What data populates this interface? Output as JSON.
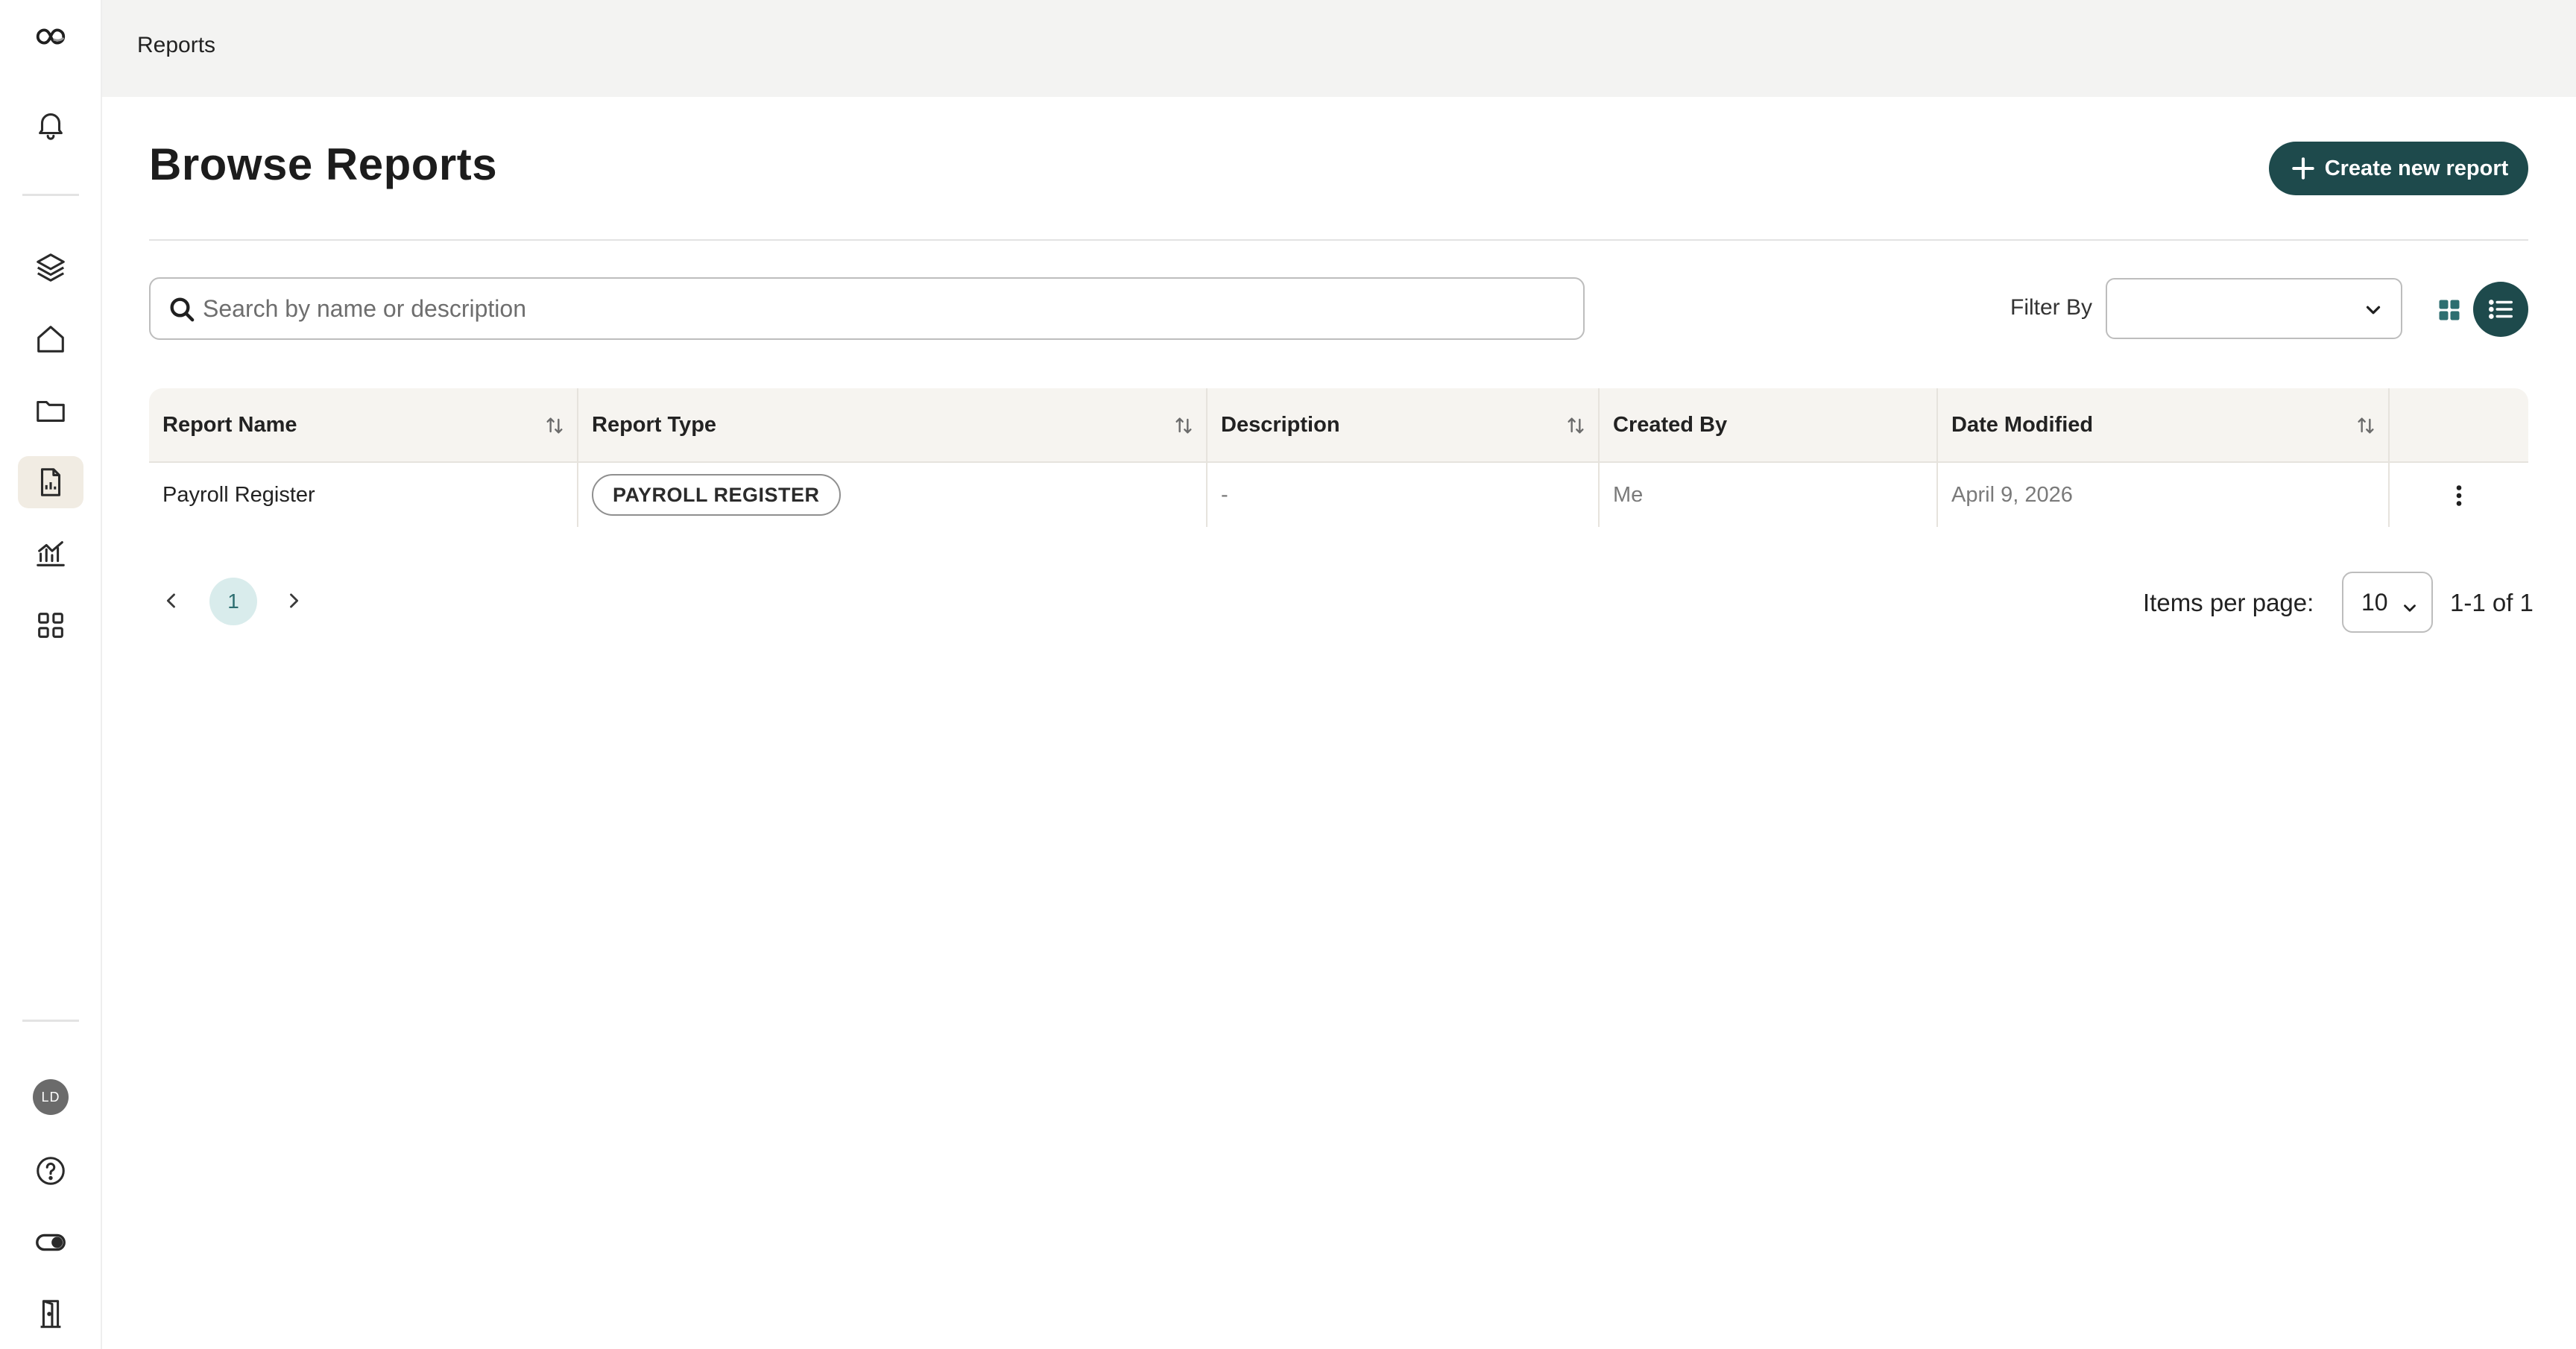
{
  "breadcrumb": {
    "current": "Reports"
  },
  "page": {
    "title": "Browse Reports",
    "create_button_label": "Create new report"
  },
  "search": {
    "value": "",
    "placeholder": "Search by name or description"
  },
  "filter": {
    "label": "Filter By",
    "selected": ""
  },
  "sidebar": {
    "avatar_initials": "LD",
    "active_item": "reports",
    "items": [
      {
        "id": "notifications",
        "icon": "bell-icon"
      },
      {
        "id": "layers",
        "icon": "layers-icon"
      },
      {
        "id": "home",
        "icon": "home-icon"
      },
      {
        "id": "files",
        "icon": "folder-icon"
      },
      {
        "id": "reports",
        "icon": "report-document-icon"
      },
      {
        "id": "analytics",
        "icon": "line-chart-icon"
      },
      {
        "id": "apps",
        "icon": "grid-icon"
      },
      {
        "id": "help",
        "icon": "help-icon"
      },
      {
        "id": "theme-toggle",
        "icon": "toggle-icon"
      },
      {
        "id": "logout",
        "icon": "door-icon"
      }
    ]
  },
  "table": {
    "columns": [
      "Report Name",
      "Report Type",
      "Description",
      "Created By",
      "Date Modified"
    ],
    "rows": [
      {
        "name": "Payroll Register",
        "type": "PAYROLL REGISTER",
        "description": "-",
        "created_by": "Me",
        "date_modified": "April 9, 2026"
      }
    ]
  },
  "pagination": {
    "current_page": "1",
    "items_per_page_label": "Items per page:",
    "items_per_page": "10",
    "range_text": "1-1 of 1"
  },
  "colors": {
    "accent": "#1e4a4c",
    "active_nav_bg": "#f1ece3",
    "table_header_bg": "#f6f4f0",
    "page_chip_bg": "#d9ecec"
  }
}
